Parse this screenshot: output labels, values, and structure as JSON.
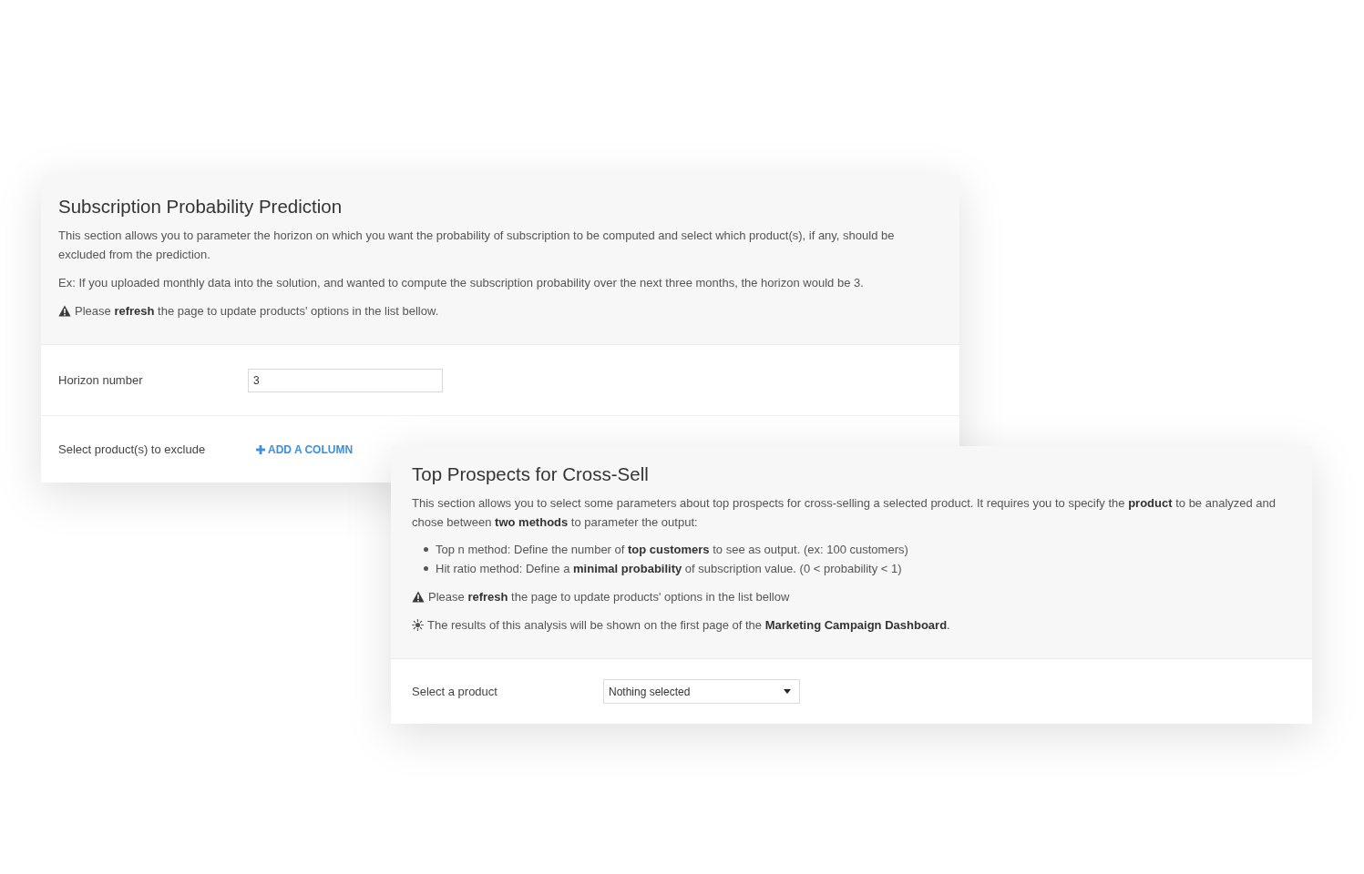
{
  "panels": [
    {
      "title": "Subscription Probability Prediction",
      "description": [
        {
          "kind": "text",
          "text": "This section allows you to parameter the horizon on which you want the probability of subscription to be computed and select which product(s), if any, should be excluded from the prediction."
        },
        {
          "kind": "text",
          "text": "Ex: If you uploaded monthly data into the solution, and wanted to compute the subscription probability over the next three months, the horizon would be 3."
        },
        {
          "kind": "warning",
          "text": "Please **refresh** the page to update products' options in the list bellow."
        }
      ],
      "fields": [
        {
          "kind": "input",
          "label": "Horizon number",
          "value": "3"
        },
        {
          "kind": "link",
          "label": "Select product(s) to exclude",
          "link": "ADD A COLUMN"
        }
      ]
    },
    {
      "title": "Top Prospects for Cross-Sell",
      "description": [
        {
          "kind": "text",
          "text": "This section allows you to select some parameters about top prospects for cross-selling a selected product. It requires you to specify the **product** to be analyzed and chose between **two methods** to parameter the output:"
        },
        {
          "kind": "list",
          "items": [
            "Top n method: Define the number of **top customers** to see as output. (ex: 100 customers)",
            "Hit ratio method: Define a **minimal probability** of subscription value. (0 < probability < 1)"
          ]
        },
        {
          "kind": "warning",
          "text": "Please **refresh** the page to update products' options in the list bellow"
        },
        {
          "kind": "note",
          "text": "The results of this analysis will be shown on the first page of the **Marketing Campaign Dashboard**."
        }
      ],
      "fields": [
        {
          "kind": "dropdown",
          "label": "Select a product",
          "value": "Nothing selected"
        }
      ]
    }
  ]
}
